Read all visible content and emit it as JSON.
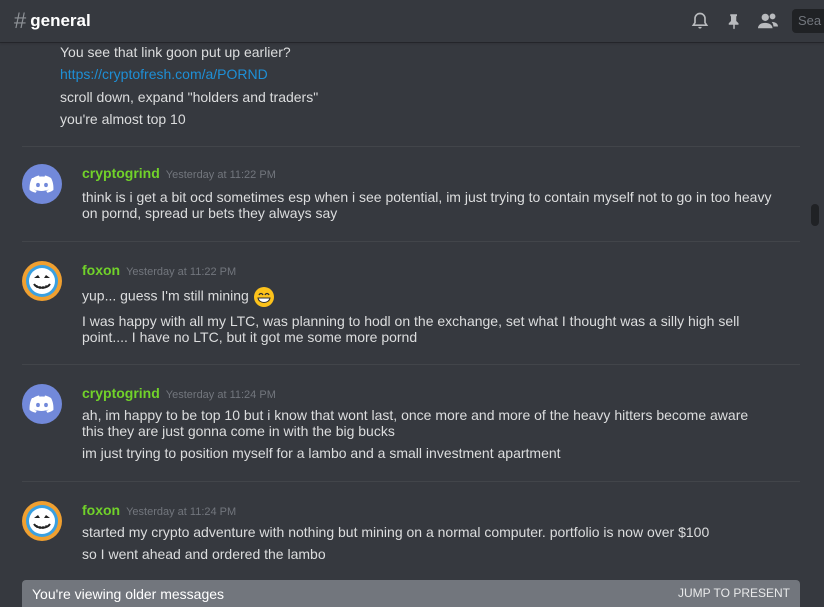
{
  "header": {
    "hash": "#",
    "channel": "general",
    "search_placeholder": "Sea",
    "icons": [
      "bell-icon",
      "pin-icon",
      "members-icon"
    ]
  },
  "messages": {
    "continued": {
      "lines": [
        "You see that link goon put up earlier?",
        "https://cryptofresh.com/a/PORND",
        "scroll down, expand \"holders and traders\"",
        "you're almost top 10"
      ]
    },
    "groups": [
      {
        "author": "cryptogrind",
        "timestamp": "Yesterday at 11:22 PM",
        "avatar": "discord-icon",
        "lines": [
          "think is i get a bit ocd sometimes esp when i see potential, im just trying to contain myself not to go in too heavy on pornd, spread ur bets they always say"
        ]
      },
      {
        "author": "foxon",
        "timestamp": "Yesterday at 11:22 PM",
        "avatar": "skull-avatar",
        "lines": [
          "yup... guess I'm still mining",
          "I was happy with all my LTC, was planning to hodl on the exchange, set what I thought was a silly high sell point.... I have no LTC, but it got me some more pornd"
        ]
      },
      {
        "author": "cryptogrind",
        "timestamp": "Yesterday at 11:24 PM",
        "avatar": "discord-icon",
        "lines": [
          "ah, im happy to be top 10 but i know that wont last, once more and more of the heavy hitters become aware this they are just gonna come in with the big bucks",
          "im just trying to position myself for a lambo and a small investment apartment"
        ]
      },
      {
        "author": "foxon",
        "timestamp": "Yesterday at 11:24 PM",
        "avatar": "skull-avatar",
        "lines": [
          "started my crypto adventure with nothing but mining on a normal computer. portfolio is now over $100",
          "so I went ahead and ordered the lambo"
        ]
      }
    ]
  },
  "footer": {
    "older_text": "You're viewing older messages",
    "jump_label": "JUMP TO PRESENT"
  },
  "colors": {
    "background": "#36393f",
    "username": "#71d22a",
    "link": "#1e8fd6",
    "discord_blurple": "#7289da",
    "foxon_ring": "#f0a030",
    "foxon_inner": "#3aa0e0"
  }
}
